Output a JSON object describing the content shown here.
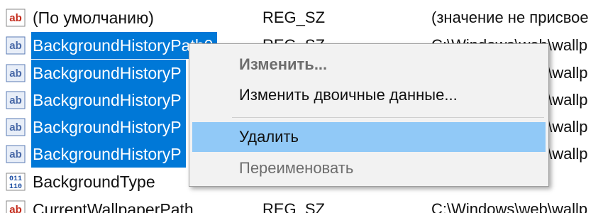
{
  "rows": [
    {
      "icon": "string-value-icon",
      "name": "(По умолчанию)",
      "type": "REG_SZ",
      "value": "(значение не присвое",
      "selected": false
    },
    {
      "icon": "string-value-icon",
      "name": "BackgroundHistoryPath0",
      "type": "REG_SZ",
      "value": "C:\\Windows\\web\\wallp",
      "selected": true
    },
    {
      "icon": "string-value-icon",
      "name": "BackgroundHistoryP",
      "type": "",
      "value": "o\\wallp",
      "selected": true
    },
    {
      "icon": "string-value-icon",
      "name": "BackgroundHistoryP",
      "type": "",
      "value": "o\\wallp",
      "selected": true
    },
    {
      "icon": "string-value-icon",
      "name": "BackgroundHistoryP",
      "type": "",
      "value": "o\\wallp",
      "selected": true
    },
    {
      "icon": "string-value-icon",
      "name": "BackgroundHistoryP",
      "type": "",
      "value": "o\\wallp",
      "selected": true
    },
    {
      "icon": "binary-value-icon",
      "name": "BackgroundType",
      "type": "",
      "value": "",
      "selected": false
    },
    {
      "icon": "string-value-icon",
      "name": "CurrentWallpaperPath",
      "type": "REG_SZ",
      "value": "C:\\Windows\\web\\wallp",
      "selected": false
    }
  ],
  "context_menu": {
    "items": [
      {
        "label": "Изменить...",
        "state": "disabled"
      },
      {
        "label": "Изменить двоичные данные...",
        "state": "normal"
      },
      {
        "label": "Удалить",
        "state": "highlighted"
      },
      {
        "label": "Переименовать",
        "state": "disabled"
      }
    ]
  },
  "colors": {
    "selection": "#0078d7",
    "menu_highlight": "#91c9f7",
    "menu_background": "#f2f2f2",
    "string_icon_red": "#c42b1c",
    "binary_icon_blue": "#1e4fa3"
  }
}
